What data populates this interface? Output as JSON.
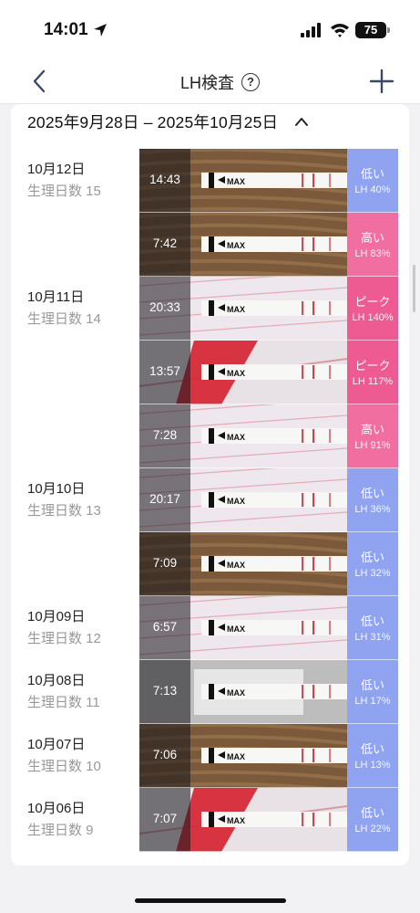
{
  "status_bar": {
    "time": "14:01",
    "battery": "75"
  },
  "nav": {
    "title": "LH検査",
    "help_glyph": "?"
  },
  "range": {
    "label": "2025年9月28日 – 2025年10月25日"
  },
  "colors": {
    "low": "#8fa3f0",
    "high": "#f06fa0",
    "peak": "#ee5b93"
  },
  "days": [
    {
      "date": "10月12日",
      "cycle": "生理日数 15"
    },
    {
      "date": "10月11日",
      "cycle": "生理日数 14"
    },
    {
      "date": "10月10日",
      "cycle": "生理日数 13"
    },
    {
      "date": "10月09日",
      "cycle": "生理日数 12"
    },
    {
      "date": "10月08日",
      "cycle": "生理日数 11"
    },
    {
      "date": "10月07日",
      "cycle": "生理日数 10"
    },
    {
      "date": "10月06日",
      "cycle": "生理日数 9"
    }
  ],
  "tests": [
    {
      "time": "14:43",
      "level": "低い",
      "lh": "LH 40%",
      "kind": "low",
      "photo": "wood"
    },
    {
      "time": "7:42",
      "level": "高い",
      "lh": "LH 83%",
      "kind": "high",
      "photo": "wood"
    },
    {
      "time": "20:33",
      "level": "ピーク",
      "lh": "LH 140%",
      "kind": "peak",
      "photo": "pack"
    },
    {
      "time": "13:57",
      "level": "ピーク",
      "lh": "LH 117%",
      "kind": "peak",
      "photo": "packred"
    },
    {
      "time": "7:28",
      "level": "高い",
      "lh": "LH 91%",
      "kind": "high",
      "photo": "pack"
    },
    {
      "time": "20:17",
      "level": "低い",
      "lh": "LH 36%",
      "kind": "low",
      "photo": "pack"
    },
    {
      "time": "7:09",
      "level": "低い",
      "lh": "LH 32%",
      "kind": "low",
      "photo": "wood"
    },
    {
      "time": "6:57",
      "level": "低い",
      "lh": "LH 31%",
      "kind": "low",
      "photo": "pack"
    },
    {
      "time": "7:13",
      "level": "低い",
      "lh": "LH 17%",
      "kind": "low",
      "photo": "grey"
    },
    {
      "time": "7:06",
      "level": "低い",
      "lh": "LH 13%",
      "kind": "low",
      "photo": "wood"
    },
    {
      "time": "7:07",
      "level": "低い",
      "lh": "LH 22%",
      "kind": "low",
      "photo": "packred"
    }
  ],
  "strip_text": {
    "max": "MAX"
  }
}
